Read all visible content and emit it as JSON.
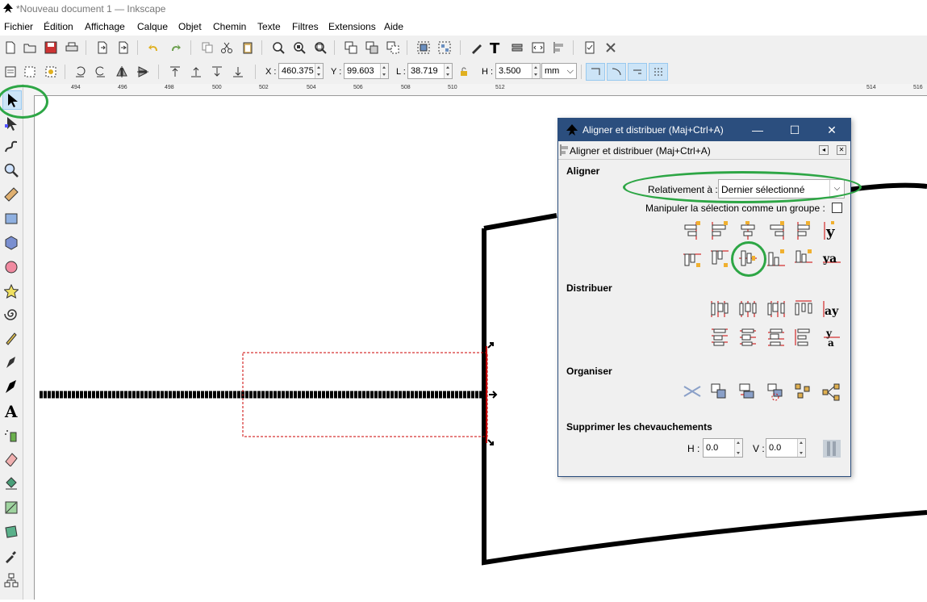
{
  "window": {
    "title": "*Nouveau document 1 — Inkscape"
  },
  "menu": [
    "Fichier",
    "Édition",
    "Affichage",
    "Calque",
    "Objet",
    "Chemin",
    "Texte",
    "Filtres",
    "Extensions",
    "Aide"
  ],
  "controls": {
    "x_label": "X :",
    "x_value": "460.375",
    "y_label": "Y :",
    "y_value": "99.603",
    "w_label": "L :",
    "w_value": "38.719",
    "h_label": "H :",
    "h_value": "3.500",
    "unit": "mm"
  },
  "ruler": {
    "marks": [
      "494",
      "496",
      "498",
      "500",
      "502",
      "504",
      "506",
      "508",
      "510",
      "512",
      "514",
      "516"
    ]
  },
  "dialog": {
    "title": "Aligner et distribuer (Maj+Ctrl+A)",
    "tab_label": "Aligner et distribuer (Maj+Ctrl+A)",
    "align": {
      "heading": "Aligner",
      "relative_label": "Relativement à :",
      "relative_value": "Dernier sélectionné",
      "group_label": "Manipuler la sélection comme un groupe :"
    },
    "distribute": {
      "heading": "Distribuer"
    },
    "arrange": {
      "heading": "Organiser"
    },
    "overlap": {
      "heading": "Supprimer les chevauchements",
      "h_label": "H :",
      "h_value": "0.0",
      "v_label": "V :",
      "v_value": "0.0"
    }
  },
  "colors": {
    "highlight": "#2da645",
    "dialog_title": "#2b4e7e",
    "selection": "#cc0000"
  }
}
